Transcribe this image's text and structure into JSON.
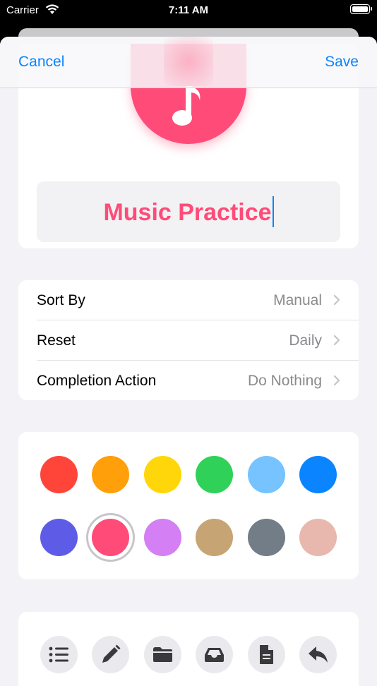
{
  "status_bar": {
    "carrier": "Carrier",
    "time": "7:11 AM"
  },
  "nav": {
    "cancel_label": "Cancel",
    "save_label": "Save"
  },
  "list": {
    "name": "Music Practice",
    "icon": "music-note-icon",
    "color": "#ff4b78"
  },
  "settings": [
    {
      "label": "Sort By",
      "value": "Manual"
    },
    {
      "label": "Reset",
      "value": "Daily"
    },
    {
      "label": "Completion Action",
      "value": "Do Nothing"
    }
  ],
  "colors": [
    "#ff453a",
    "#ff9f0a",
    "#ffd60a",
    "#30d158",
    "#76c3ff",
    "#0a84ff",
    "#5e5ce6",
    "#ff4b78",
    "#d47ff3",
    "#c7a473",
    "#737d88",
    "#e8b7ae"
  ],
  "selected_color_index": 7,
  "tool_icons": [
    "list-icon",
    "pencil-icon",
    "folder-icon",
    "tray-icon",
    "document-icon",
    "reply-icon"
  ]
}
